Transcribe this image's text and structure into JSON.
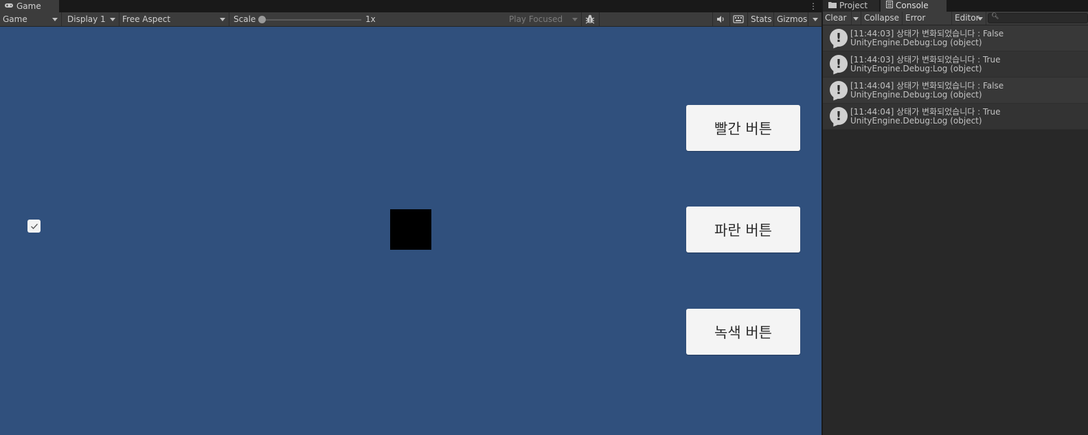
{
  "game_panel": {
    "tab_title": "Game",
    "more_icon": "kebab-menu-icon",
    "toolbar": {
      "mode": "Game",
      "display": "Display 1",
      "aspect": "Free Aspect",
      "scale_label": "Scale",
      "scale_value": "1x",
      "scale_level": 0,
      "play_mode": "Play Focused",
      "stats": "Stats",
      "gizmos": "Gizmos"
    },
    "viewport": {
      "background": "#30507d",
      "buttons": [
        {
          "label": "빨간 버튼"
        },
        {
          "label": "파란 버튼"
        },
        {
          "label": "녹색 버튼"
        }
      ],
      "toggle_checked": true,
      "square_color": "#000000"
    }
  },
  "console_panel": {
    "tabs": [
      {
        "label": "Project",
        "icon": "folder-icon"
      },
      {
        "label": "Console",
        "icon": "console-icon"
      }
    ],
    "toolbar": {
      "clear": "Clear",
      "collapse": "Collapse",
      "error_pause": "Error Pause",
      "editor": "Editor"
    },
    "logs": [
      {
        "message": "[11:44:03] 상태가 변화되었습니다 : False",
        "source": "UnityEngine.Debug:Log (object)"
      },
      {
        "message": "[11:44:03] 상태가 변화되었습니다 : True",
        "source": "UnityEngine.Debug:Log (object)"
      },
      {
        "message": "[11:44:04] 상태가 변화되었습니다 : False",
        "source": "UnityEngine.Debug:Log (object)"
      },
      {
        "message": "[11:44:04] 상태가 변화되었습니다 : True",
        "source": "UnityEngine.Debug:Log (object)"
      }
    ]
  }
}
